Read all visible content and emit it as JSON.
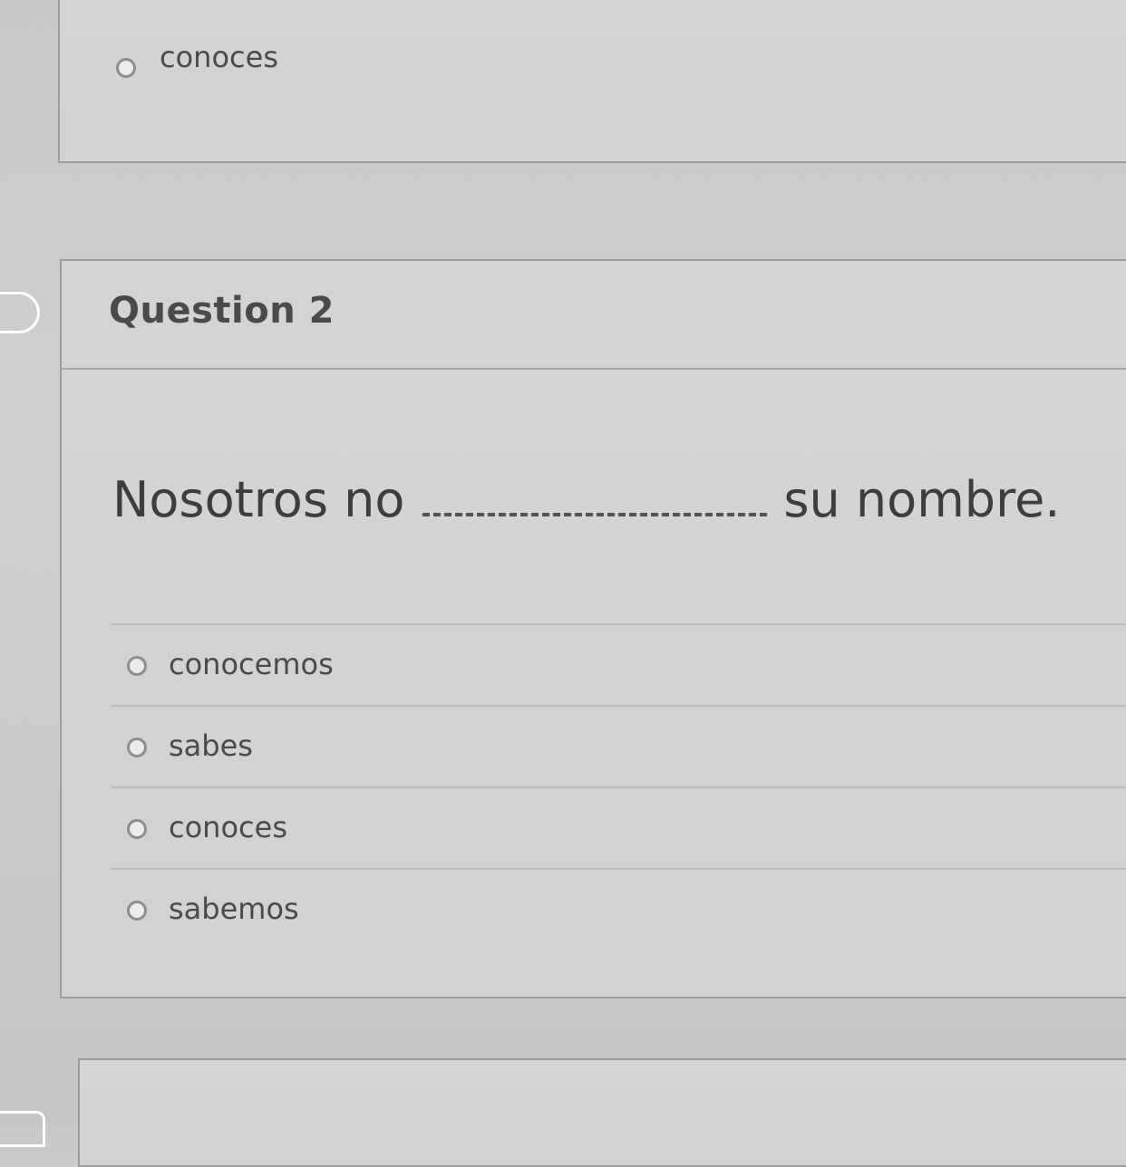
{
  "previous_question": {
    "answers": [
      {
        "label": "conoces"
      }
    ]
  },
  "question": {
    "title": "Question 2",
    "text_before": "Nosotros no",
    "text_after": "su nombre.",
    "answers": [
      {
        "label": "conocemos"
      },
      {
        "label": "sabes"
      },
      {
        "label": "conoces"
      },
      {
        "label": "sabemos"
      }
    ]
  },
  "icons": {
    "question_flag": "flag-tab-icon",
    "radio": "radio-unselected-icon"
  },
  "colors": {
    "background": "#cfcfcd",
    "card_border": "#9d9d9b",
    "text": "#4a4a4a"
  }
}
